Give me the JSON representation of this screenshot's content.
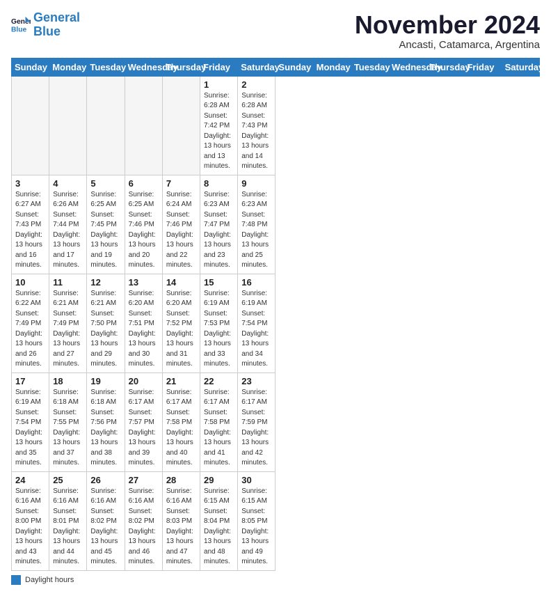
{
  "logo": {
    "line1": "General",
    "line2": "Blue"
  },
  "title": "November 2024",
  "location": "Ancasti, Catamarca, Argentina",
  "days_of_week": [
    "Sunday",
    "Monday",
    "Tuesday",
    "Wednesday",
    "Thursday",
    "Friday",
    "Saturday"
  ],
  "legend_label": "Daylight hours",
  "weeks": [
    [
      {
        "day": "",
        "info": ""
      },
      {
        "day": "",
        "info": ""
      },
      {
        "day": "",
        "info": ""
      },
      {
        "day": "",
        "info": ""
      },
      {
        "day": "",
        "info": ""
      },
      {
        "day": "1",
        "info": "Sunrise: 6:28 AM\nSunset: 7:42 PM\nDaylight: 13 hours\nand 13 minutes."
      },
      {
        "day": "2",
        "info": "Sunrise: 6:28 AM\nSunset: 7:43 PM\nDaylight: 13 hours\nand 14 minutes."
      }
    ],
    [
      {
        "day": "3",
        "info": "Sunrise: 6:27 AM\nSunset: 7:43 PM\nDaylight: 13 hours\nand 16 minutes."
      },
      {
        "day": "4",
        "info": "Sunrise: 6:26 AM\nSunset: 7:44 PM\nDaylight: 13 hours\nand 17 minutes."
      },
      {
        "day": "5",
        "info": "Sunrise: 6:25 AM\nSunset: 7:45 PM\nDaylight: 13 hours\nand 19 minutes."
      },
      {
        "day": "6",
        "info": "Sunrise: 6:25 AM\nSunset: 7:46 PM\nDaylight: 13 hours\nand 20 minutes."
      },
      {
        "day": "7",
        "info": "Sunrise: 6:24 AM\nSunset: 7:46 PM\nDaylight: 13 hours\nand 22 minutes."
      },
      {
        "day": "8",
        "info": "Sunrise: 6:23 AM\nSunset: 7:47 PM\nDaylight: 13 hours\nand 23 minutes."
      },
      {
        "day": "9",
        "info": "Sunrise: 6:23 AM\nSunset: 7:48 PM\nDaylight: 13 hours\nand 25 minutes."
      }
    ],
    [
      {
        "day": "10",
        "info": "Sunrise: 6:22 AM\nSunset: 7:49 PM\nDaylight: 13 hours\nand 26 minutes."
      },
      {
        "day": "11",
        "info": "Sunrise: 6:21 AM\nSunset: 7:49 PM\nDaylight: 13 hours\nand 27 minutes."
      },
      {
        "day": "12",
        "info": "Sunrise: 6:21 AM\nSunset: 7:50 PM\nDaylight: 13 hours\nand 29 minutes."
      },
      {
        "day": "13",
        "info": "Sunrise: 6:20 AM\nSunset: 7:51 PM\nDaylight: 13 hours\nand 30 minutes."
      },
      {
        "day": "14",
        "info": "Sunrise: 6:20 AM\nSunset: 7:52 PM\nDaylight: 13 hours\nand 31 minutes."
      },
      {
        "day": "15",
        "info": "Sunrise: 6:19 AM\nSunset: 7:53 PM\nDaylight: 13 hours\nand 33 minutes."
      },
      {
        "day": "16",
        "info": "Sunrise: 6:19 AM\nSunset: 7:54 PM\nDaylight: 13 hours\nand 34 minutes."
      }
    ],
    [
      {
        "day": "17",
        "info": "Sunrise: 6:19 AM\nSunset: 7:54 PM\nDaylight: 13 hours\nand 35 minutes."
      },
      {
        "day": "18",
        "info": "Sunrise: 6:18 AM\nSunset: 7:55 PM\nDaylight: 13 hours\nand 37 minutes."
      },
      {
        "day": "19",
        "info": "Sunrise: 6:18 AM\nSunset: 7:56 PM\nDaylight: 13 hours\nand 38 minutes."
      },
      {
        "day": "20",
        "info": "Sunrise: 6:17 AM\nSunset: 7:57 PM\nDaylight: 13 hours\nand 39 minutes."
      },
      {
        "day": "21",
        "info": "Sunrise: 6:17 AM\nSunset: 7:58 PM\nDaylight: 13 hours\nand 40 minutes."
      },
      {
        "day": "22",
        "info": "Sunrise: 6:17 AM\nSunset: 7:58 PM\nDaylight: 13 hours\nand 41 minutes."
      },
      {
        "day": "23",
        "info": "Sunrise: 6:17 AM\nSunset: 7:59 PM\nDaylight: 13 hours\nand 42 minutes."
      }
    ],
    [
      {
        "day": "24",
        "info": "Sunrise: 6:16 AM\nSunset: 8:00 PM\nDaylight: 13 hours\nand 43 minutes."
      },
      {
        "day": "25",
        "info": "Sunrise: 6:16 AM\nSunset: 8:01 PM\nDaylight: 13 hours\nand 44 minutes."
      },
      {
        "day": "26",
        "info": "Sunrise: 6:16 AM\nSunset: 8:02 PM\nDaylight: 13 hours\nand 45 minutes."
      },
      {
        "day": "27",
        "info": "Sunrise: 6:16 AM\nSunset: 8:02 PM\nDaylight: 13 hours\nand 46 minutes."
      },
      {
        "day": "28",
        "info": "Sunrise: 6:16 AM\nSunset: 8:03 PM\nDaylight: 13 hours\nand 47 minutes."
      },
      {
        "day": "29",
        "info": "Sunrise: 6:15 AM\nSunset: 8:04 PM\nDaylight: 13 hours\nand 48 minutes."
      },
      {
        "day": "30",
        "info": "Sunrise: 6:15 AM\nSunset: 8:05 PM\nDaylight: 13 hours\nand 49 minutes."
      }
    ]
  ]
}
